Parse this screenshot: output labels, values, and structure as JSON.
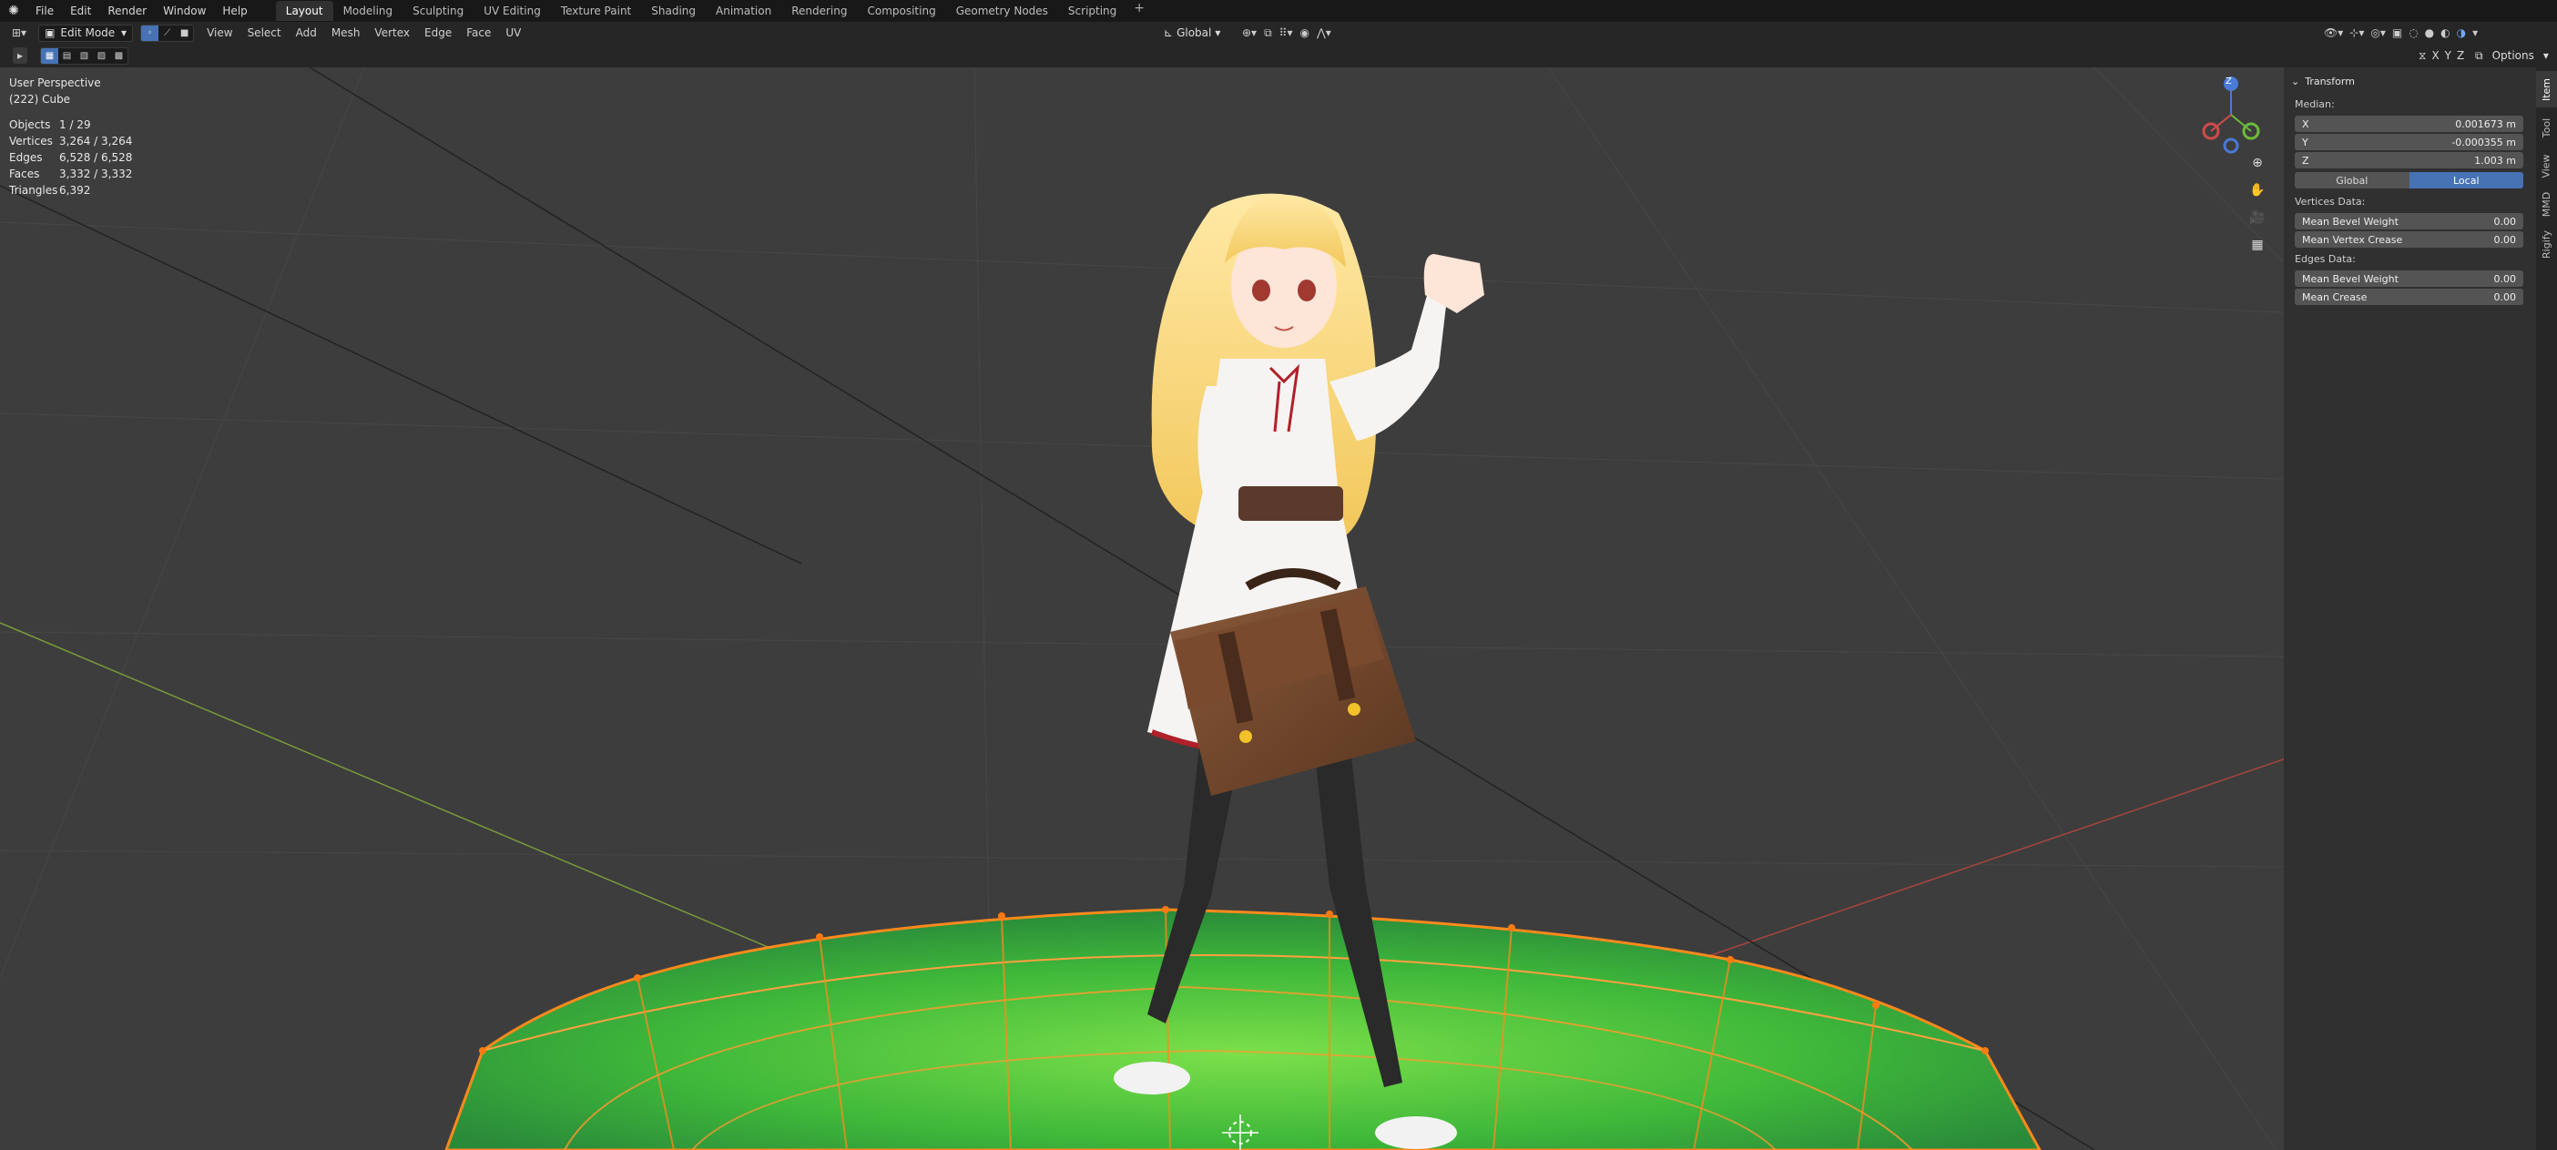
{
  "topbar": {
    "menus": [
      "File",
      "Edit",
      "Render",
      "Window",
      "Help"
    ],
    "workspaces": [
      "Layout",
      "Modeling",
      "Sculpting",
      "UV Editing",
      "Texture Paint",
      "Shading",
      "Animation",
      "Rendering",
      "Compositing",
      "Geometry Nodes",
      "Scripting"
    ],
    "active_workspace": "Layout",
    "add_symbol": "+"
  },
  "header": {
    "mode": "Edit Mode",
    "menus": [
      "View",
      "Select",
      "Add",
      "Mesh",
      "Vertex",
      "Edge",
      "Face",
      "UV"
    ],
    "orientation": "Global",
    "axis_labels": [
      "X",
      "Y",
      "Z"
    ],
    "options_label": "Options"
  },
  "viewport": {
    "view_name": "User Perspective",
    "object_name": "(222) Cube",
    "stats": [
      {
        "label": "Objects",
        "value": "1 / 29"
      },
      {
        "label": "Vertices",
        "value": "3,264 / 3,264"
      },
      {
        "label": "Edges",
        "value": "6,528 / 6,528"
      },
      {
        "label": "Faces",
        "value": "3,332 / 3,332"
      },
      {
        "label": "Triangles",
        "value": "6,392"
      }
    ],
    "gizmo_axis_label": "Z"
  },
  "npanel": {
    "title": "Transform",
    "median_label": "Median:",
    "x": {
      "label": "X",
      "value": "0.001673 m"
    },
    "y": {
      "label": "Y",
      "value": "-0.000355 m"
    },
    "z": {
      "label": "Z",
      "value": "1.003 m"
    },
    "space_options": [
      "Global",
      "Local"
    ],
    "space_active": "Local",
    "vertices_data_label": "Vertices Data:",
    "mean_bevel_weight_v": {
      "label": "Mean Bevel Weight",
      "value": "0.00"
    },
    "mean_vertex_crease": {
      "label": "Mean Vertex Crease",
      "value": "0.00"
    },
    "edges_data_label": "Edges Data:",
    "mean_bevel_weight_e": {
      "label": "Mean Bevel Weight",
      "value": "0.00"
    },
    "mean_crease": {
      "label": "Mean Crease",
      "value": "0.00"
    }
  },
  "sidebar_tabs": [
    "Item",
    "Tool",
    "View",
    "MMD",
    "Rigify"
  ],
  "sidebar_tab_active": "Item"
}
